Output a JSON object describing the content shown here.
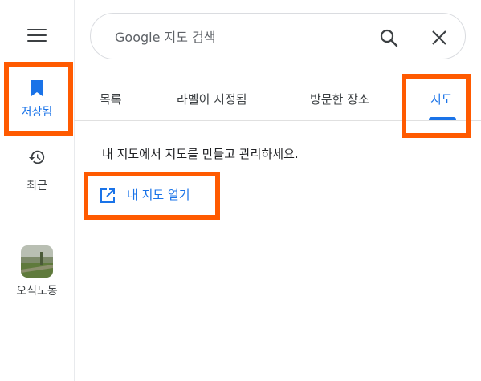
{
  "rail": {
    "menu_icon": "menu-icon",
    "saved": {
      "label": "저장됨",
      "icon": "bookmark-icon"
    },
    "recent": {
      "label": "최근",
      "icon": "history-icon"
    },
    "place": {
      "label": "오식도동"
    }
  },
  "search": {
    "placeholder": "Google 지도 검색",
    "value": ""
  },
  "tabs": [
    {
      "label": "목록"
    },
    {
      "label": "라벨이 지정됨"
    },
    {
      "label": "방문한 장소"
    },
    {
      "label": "지도",
      "active": true
    }
  ],
  "maps_panel": {
    "description": "내 지도에서 지도를 만들고 관리하세요.",
    "open_link_label": "내 지도 열기"
  },
  "colors": {
    "accent": "#1a73e8",
    "highlight": "#ff5a00"
  }
}
